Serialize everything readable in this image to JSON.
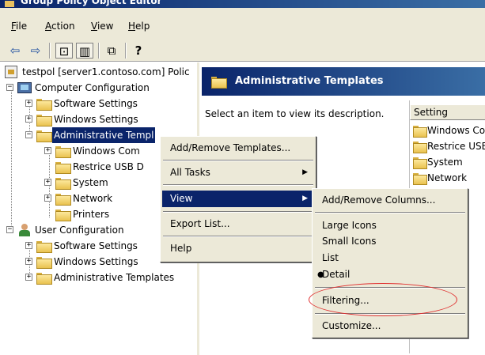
{
  "window": {
    "title": "Group Policy Object Editor"
  },
  "menu": {
    "file": "File",
    "action": "Action",
    "view": "View",
    "help": "Help"
  },
  "toolbar": {
    "back": "⇦",
    "forward": "⇨",
    "up": "⊡",
    "show_hide_tree": "▥",
    "export": "⧉",
    "help": "?"
  },
  "tree": {
    "root": "testpol [server1.contoso.com] Polic",
    "computer_config": "Computer Configuration",
    "cc_software": "Software Settings",
    "cc_windows": "Windows Settings",
    "cc_admin": "Administrative Templ",
    "cc_admin_windows_comp": "Windows Com",
    "cc_admin_restrict_usb": "Restrice USB D",
    "cc_admin_system": "System",
    "cc_admin_network": "Network",
    "cc_admin_printers": "Printers",
    "user_config": "User Configuration",
    "uc_software": "Software Settings",
    "uc_windows": "Windows Settings",
    "uc_admin": "Administrative Templates"
  },
  "right": {
    "header_title": "Administrative Templates",
    "description": "Select an item to view its description.",
    "column_setting": "Setting",
    "items": [
      "Windows Co",
      "Restrice USB",
      "System",
      "Network"
    ]
  },
  "context_menu": {
    "add_remove_templates": "Add/Remove Templates...",
    "all_tasks": "All Tasks",
    "view": "View",
    "export_list": "Export List...",
    "help": "Help"
  },
  "view_submenu": {
    "add_remove_columns": "Add/Remove Columns...",
    "large_icons": "Large Icons",
    "small_icons": "Small Icons",
    "list": "List",
    "detail": "Detail",
    "filtering": "Filtering...",
    "customize": "Customize..."
  },
  "colors": {
    "selection": "#0a246a",
    "menu_bg": "#ece9d8",
    "annotation": "#e03030"
  }
}
